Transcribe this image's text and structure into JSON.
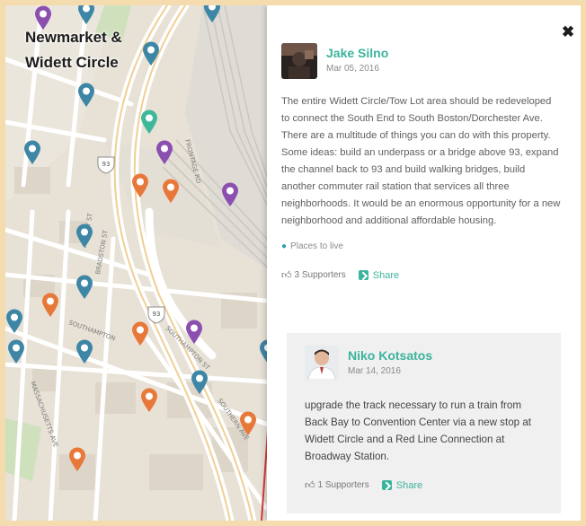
{
  "map": {
    "title_lines": [
      "Newmarket &",
      "Widett Circle"
    ],
    "route_shields": [
      "93",
      "93"
    ],
    "street_labels": [
      "SOUTHAMPTON",
      "SOUTHAMPTON ST",
      "MASSACHUSETTS AVE",
      "ALBANY ST",
      "BRADSTON ST",
      "SOUTHERN AVE",
      "FRONTAGE RD"
    ]
  },
  "pins": [
    {
      "color": "#8b4fb0"
    },
    {
      "color": "#3e86a6"
    },
    {
      "color": "#3e86a6"
    },
    {
      "color": "#3e86a6"
    },
    {
      "color": "#3fb79a"
    },
    {
      "color": "#3e86a6"
    },
    {
      "color": "#3e86a6"
    },
    {
      "color": "#8b4fb0"
    },
    {
      "color": "#e8783a"
    },
    {
      "color": "#e8783a"
    },
    {
      "color": "#8b4fb0"
    },
    {
      "color": "#3e86a6"
    },
    {
      "color": "#3e86a6"
    },
    {
      "color": "#e8783a"
    },
    {
      "color": "#3e86a6"
    },
    {
      "color": "#3e86a6"
    },
    {
      "color": "#e8783a"
    },
    {
      "color": "#8b4fb0"
    },
    {
      "color": "#3e86a6"
    },
    {
      "color": "#3e86a6"
    },
    {
      "color": "#e8783a"
    },
    {
      "color": "#3e86a6"
    },
    {
      "color": "#e8783a"
    },
    {
      "color": "#e8783a"
    },
    {
      "color": "#e8783a"
    },
    {
      "color": "#8b4fb0"
    },
    {
      "color": "#3e86a6"
    }
  ],
  "panel": {
    "close_icon": "close-icon",
    "post": {
      "author": "Jake Silno",
      "date": "Mar 05, 2016",
      "body": "The entire Widett Circle/Tow Lot area should be redeveloped to connect the South End to South Boston/Dorchester Ave. There are a multitude of things you can do with this property. Some ideas: build an underpass or a bridge above 93, expand the channel back to 93 and build walking bridges, build another commuter rail station that services all three neighborhoods. It would be an enormous opportunity for a new neighborhood and additional affordable housing.",
      "tag": "Places to live",
      "supporters": "3 Supporters",
      "share": "Share"
    },
    "reply": {
      "author": "Niko Kotsatos",
      "date": "Mar 14, 2016",
      "body": "upgrade the track necessary to run a train from Back Bay to Convention Center via a new stop at Widett Circle and a Red Line Connection at Broadway Station.",
      "supporters": "1 Supporters",
      "share": "Share"
    }
  },
  "colors": {
    "accent": "#3cb39c",
    "pin_blue": "#3e86a6",
    "pin_purple": "#8b4fb0",
    "pin_orange": "#e8783a",
    "pin_teal": "#3fb79a"
  }
}
